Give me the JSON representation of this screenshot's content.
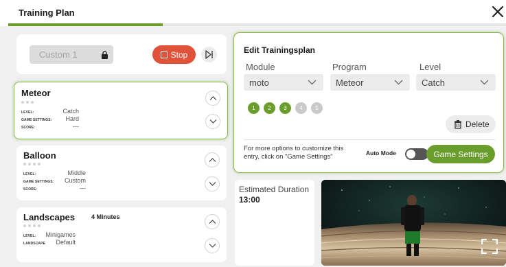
{
  "header": {
    "title": "Training Plan",
    "progress": 0.31
  },
  "left": {
    "custom_name": "Custom 1",
    "stop_label": "Stop",
    "cards": [
      {
        "title": "Meteor",
        "minutes": "",
        "rows": [
          {
            "label": "LEVEL:",
            "value": "Catch"
          },
          {
            "label": "GAME SETTINGS:",
            "value": "Hard"
          },
          {
            "label": "SCORE:",
            "value": "---"
          }
        ]
      },
      {
        "title": "Balloon",
        "minutes": "",
        "rows": [
          {
            "label": "LEVEL:",
            "value": "Middle"
          },
          {
            "label": "GAME SETTINGS:",
            "value": "Custom"
          },
          {
            "label": "SCORE:",
            "value": "---"
          }
        ]
      },
      {
        "title": "Landscapes",
        "minutes": "4 Minutes",
        "rows": [
          {
            "label": "LEVEL:",
            "value": "Minigames"
          },
          {
            "label": "LANDSCAPE",
            "value": "Default"
          }
        ]
      }
    ]
  },
  "edit": {
    "title": "Edit Trainingsplan",
    "module_label": "Module",
    "program_label": "Program",
    "level_label": "Level",
    "module_value": "moto",
    "program_value": "Meteor",
    "level_value": "Catch",
    "level_dots": [
      "1",
      "2",
      "3",
      "4",
      "5"
    ],
    "levels_active": 3,
    "delete_label": "Delete",
    "more_text": "For more options to customize this entry, click on \"Game Settings\"",
    "auto_mode_label": "Auto Mode",
    "auto_mode_on": false,
    "game_settings_label": "Game Settings"
  },
  "duration": {
    "label": "Estimated Duration",
    "value": "13:00"
  },
  "colors": {
    "accent_green": "#6a9e2c",
    "stop_red": "#e0523a"
  }
}
